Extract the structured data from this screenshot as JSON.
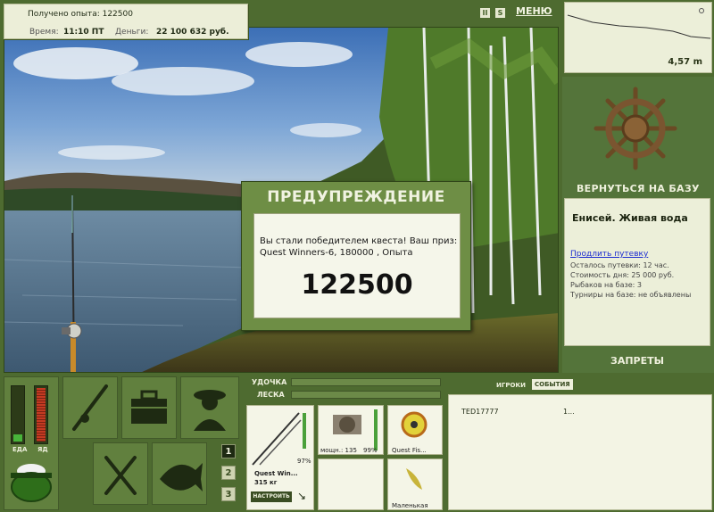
{
  "topinfo": {
    "exp_label": "Получено опыта: 122500",
    "time_label": "Время:",
    "time_value": "11:10 ПТ",
    "money_label": "Деньги:",
    "money_value": "22 100 632 руб."
  },
  "toolbar": {
    "pause": "II",
    "sound": "S",
    "menu_label": "МЕНЮ"
  },
  "depth": {
    "value": "4,57 m"
  },
  "sidebar": {
    "back_label": "ВЕРНУТЬСЯ НА БАЗУ",
    "place": "Енисей. Живая вода",
    "extend_link": "Продлить путевку",
    "lines": [
      "Осталось путевки: 12 час.",
      "Стоимость дня: 25 000 руб.",
      "Рыбаков на базе: 3",
      "Турниры на базе: не объявлены"
    ],
    "bans_label": "ЗАПРЕТЫ"
  },
  "dialog": {
    "title": "ПРЕДУПРЕЖДЕНИЕ",
    "message": "Вы стали победителем квеста! Ваш приз: Quest Winners-6, 180000 , Опыта",
    "big_value": "122500"
  },
  "meters": {
    "food": "ЕДА",
    "poison": "ЯД"
  },
  "pages": [
    "1",
    "2",
    "3"
  ],
  "tackle": {
    "rod_label": "УДОЧКА",
    "line_label": "ЛЕСКА",
    "rod_name": "Quest Win...",
    "rod_weight": "315 кг",
    "rod_percent": "97%",
    "setup_button": "НАСТРОИТЬ",
    "reel_name": "мощн.: 135",
    "reel_percent": "99%",
    "line_name": "Quest Fis...",
    "bait_name": "Маленькая"
  },
  "tabs": {
    "players": "ИГРОКИ",
    "events": "СОБЫТИЯ"
  },
  "players": [
    {
      "name": "TED17777",
      "value": "1..."
    }
  ]
}
